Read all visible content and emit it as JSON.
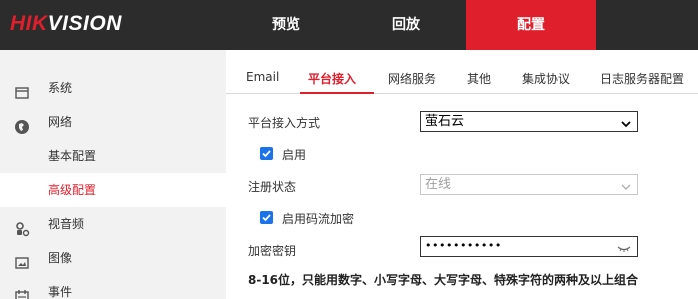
{
  "brand": {
    "logo_red": "HIK",
    "logo_white": "VISION"
  },
  "nav": {
    "items": [
      {
        "label": "预览"
      },
      {
        "label": "回放"
      },
      {
        "label": "配置"
      }
    ],
    "active_index": 2
  },
  "sidebar": {
    "items": [
      {
        "label": "系统",
        "icon": "monitor-icon"
      },
      {
        "label": "网络",
        "icon": "globe-icon"
      },
      {
        "label": "基本配置"
      },
      {
        "label": "高级配置",
        "selected": true
      },
      {
        "label": "视音频",
        "icon": "video-audio-icon"
      },
      {
        "label": "图像",
        "icon": "image-icon"
      },
      {
        "label": "事件",
        "icon": "calendar-icon"
      }
    ]
  },
  "tabs": {
    "items": [
      {
        "label": "Email"
      },
      {
        "label": "平台接入"
      },
      {
        "label": "网络服务"
      },
      {
        "label": "其他"
      },
      {
        "label": "集成协议"
      },
      {
        "label": "日志服务器配置"
      }
    ],
    "active_index": 1
  },
  "form": {
    "access_mode_label": "平台接入方式",
    "access_mode_value": "萤石云",
    "enable_label": "启用",
    "enable_checked": true,
    "reg_status_label": "注册状态",
    "reg_status_value": "在线",
    "stream_encrypt_label": "启用码流加密",
    "stream_encrypt_checked": true,
    "key_label": "加密密钥",
    "key_value": "•••••••••••",
    "hint": "8-16位，只能用数字、小写字母、大写字母、特殊字符的两种及以上组合"
  },
  "colors": {
    "accent": "#e01f2d",
    "topbar": "#2c2c2c",
    "sidebar": "#f2f2f2",
    "checkbox": "#1a73e8"
  }
}
